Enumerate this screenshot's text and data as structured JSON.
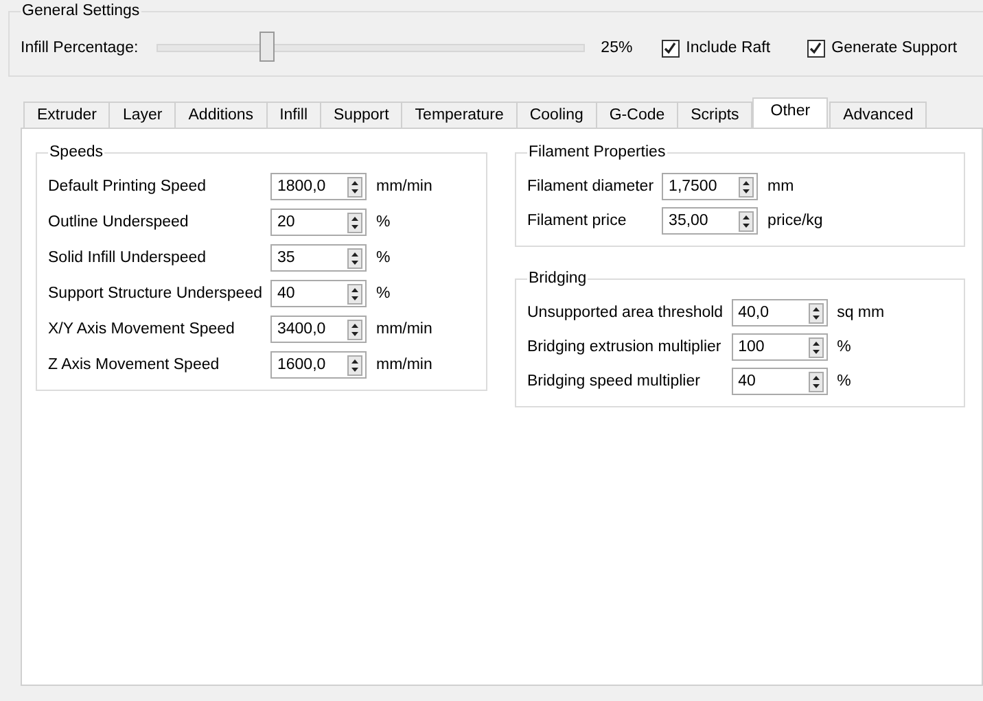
{
  "general_settings": {
    "title": "General Settings",
    "infill": {
      "label": "Infill Percentage:",
      "level": 0.25,
      "reading": "25%"
    },
    "checkboxes": [
      {
        "label": "Include Raft",
        "checked": true
      },
      {
        "label": "Generate Support",
        "checked": true
      }
    ]
  },
  "tabs": [
    {
      "label": "Extruder",
      "selected": false
    },
    {
      "label": "Layer",
      "selected": false
    },
    {
      "label": "Additions",
      "selected": false
    },
    {
      "label": "Infill",
      "selected": false
    },
    {
      "label": "Support",
      "selected": false
    },
    {
      "label": "Temperature",
      "selected": false
    },
    {
      "label": "Cooling",
      "selected": false
    },
    {
      "label": "G-Code",
      "selected": false
    },
    {
      "label": "Scripts",
      "selected": false
    },
    {
      "label": "Other",
      "selected": true
    },
    {
      "label": "Advanced",
      "selected": false
    }
  ],
  "columns": [
    [
      {
        "title": "Speeds",
        "fields": [
          {
            "label": "Default Printing Speed",
            "value": "1800,0",
            "unit": "mm/min"
          },
          {
            "label": "Outline Underspeed",
            "value": "20",
            "unit": "%"
          },
          {
            "label": "Solid Infill Underspeed",
            "value": "35",
            "unit": "%"
          },
          {
            "label": "Support Structure Underspeed",
            "value": "40",
            "unit": "%"
          },
          {
            "label": "X/Y Axis Movement Speed",
            "value": "3400,0",
            "unit": "mm/min"
          },
          {
            "label": "Z Axis Movement Speed",
            "value": "1600,0",
            "unit": "mm/min"
          }
        ]
      }
    ],
    [
      {
        "title": "Filament Properties",
        "fields": [
          {
            "label": "Filament diameter",
            "value": "1,7500",
            "unit": "mm"
          },
          {
            "label": "Filament price",
            "value": "35,00",
            "unit": "price/kg"
          }
        ]
      },
      {
        "title": "Bridging",
        "fields": [
          {
            "label": "Unsupported area threshold",
            "value": "40,0",
            "unit": "sq mm"
          },
          {
            "label": "Bridging extrusion multiplier",
            "value": "100",
            "unit": "%"
          },
          {
            "label": "Bridging speed multiplier",
            "value": "40",
            "unit": "%"
          }
        ]
      }
    ]
  ]
}
